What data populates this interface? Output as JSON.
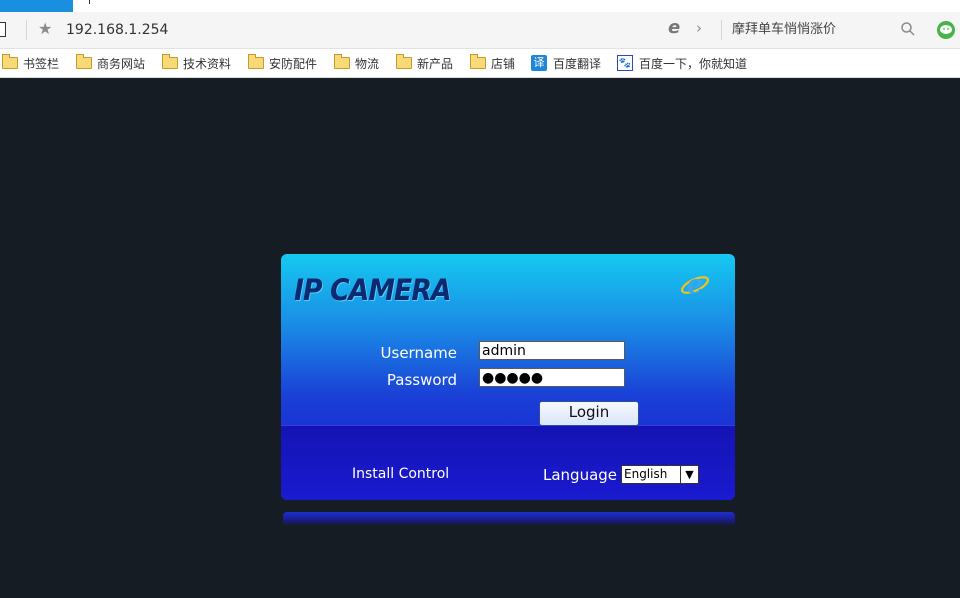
{
  "browser": {
    "url": "192.168.1.254",
    "search_text": "摩拜单车悄悄涨价"
  },
  "bookmarks": [
    {
      "label": "书签栏",
      "icon": "folder-icon"
    },
    {
      "label": "商务网站",
      "icon": "folder-icon"
    },
    {
      "label": "技术资料",
      "icon": "folder-icon"
    },
    {
      "label": "安防配件",
      "icon": "folder-icon"
    },
    {
      "label": "物流",
      "icon": "folder-icon"
    },
    {
      "label": "新产品",
      "icon": "folder-icon"
    },
    {
      "label": "店铺",
      "icon": "folder-icon"
    },
    {
      "label": "百度翻译",
      "icon": "translate-icon"
    },
    {
      "label": "百度一下，你就知道",
      "icon": "baidu-icon"
    }
  ],
  "bookmark_icon_glyphs": {
    "translate": "译",
    "baidu": "🐾"
  },
  "login": {
    "title": "IP CAMERA",
    "username_label": "Username",
    "username_value": "admin",
    "password_label": "Password",
    "password_value": "●●●●●",
    "login_button": "Login",
    "install_control": "Install Control",
    "language_label": "Language",
    "language_value": "English"
  },
  "colors": {
    "page_background": "#151c24",
    "panel_top": "#15c9f0",
    "panel_bottom": "#1a1ad0",
    "tab_accent": "#1a8fe0"
  }
}
